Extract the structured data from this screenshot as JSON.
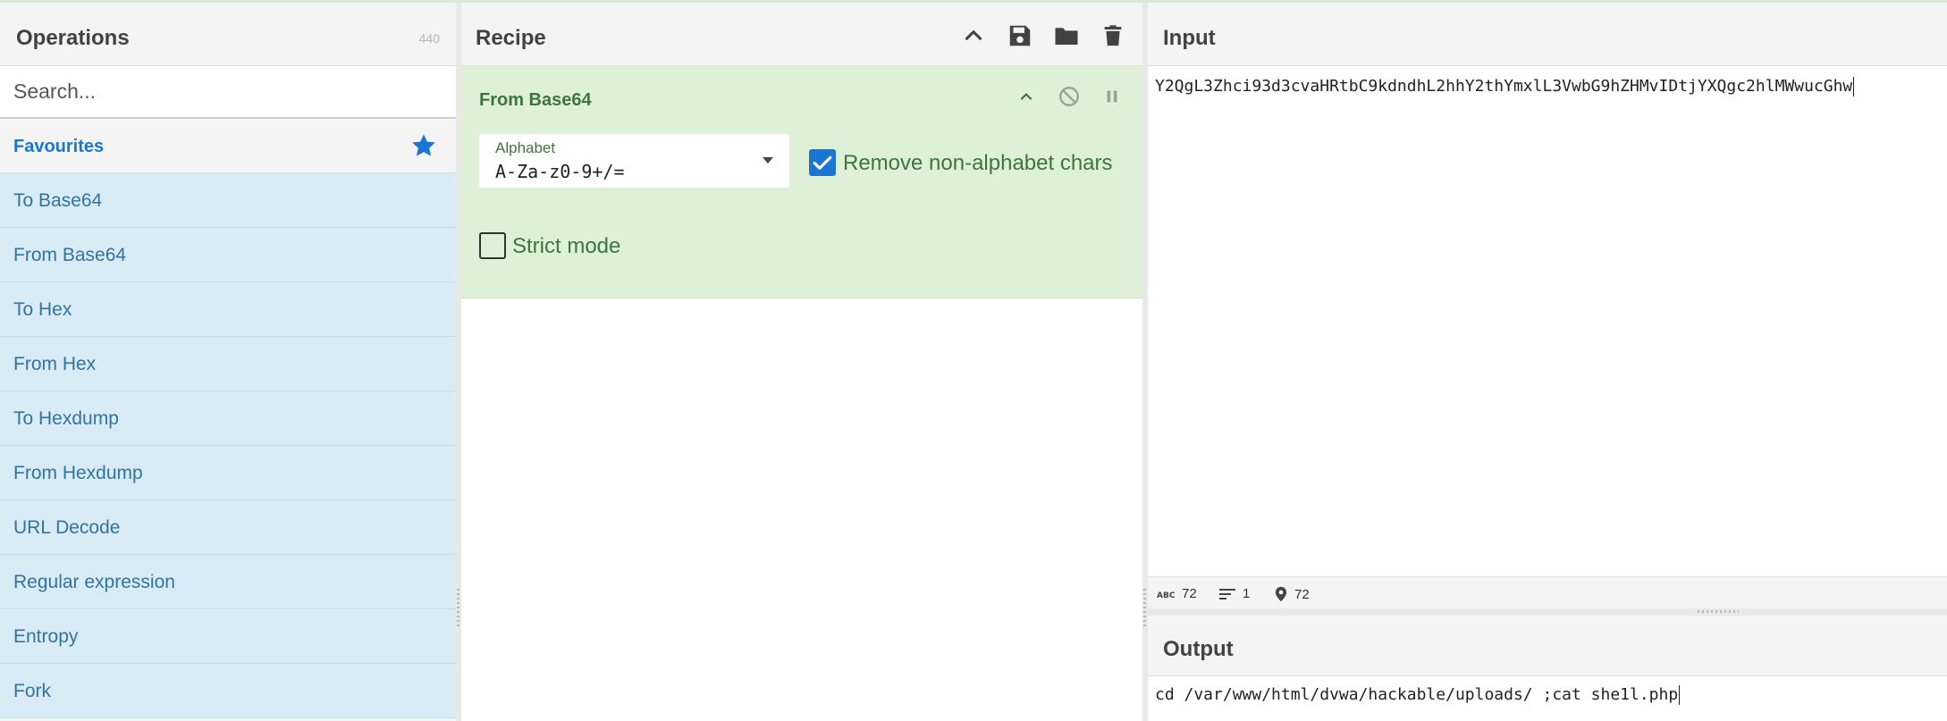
{
  "operations": {
    "title": "Operations",
    "count": "440",
    "search_placeholder": "Search...",
    "favourites_label": "Favourites",
    "items": [
      "To Base64",
      "From Base64",
      "To Hex",
      "From Hex",
      "To Hexdump",
      "From Hexdump",
      "URL Decode",
      "Regular expression",
      "Entropy",
      "Fork"
    ]
  },
  "recipe": {
    "title": "Recipe",
    "operation": {
      "name": "From Base64",
      "alphabet_label": "Alphabet",
      "alphabet_value": "A-Za-z0-9+/=",
      "remove_non_alphabet_label": "Remove non-alphabet chars",
      "remove_non_alphabet_checked": true,
      "strict_mode_label": "Strict mode",
      "strict_mode_checked": false
    }
  },
  "input": {
    "title": "Input",
    "value": "Y2QgL3Zhci93d3cvaHRtbC9kdndhL2hhY2thYmxlL3VwbG9hZHMvIDtjYXQgc2hlMWwucGhw",
    "stats": {
      "length": "72",
      "lines": "1",
      "position": "72"
    }
  },
  "output": {
    "title": "Output",
    "value": "cd /var/www/html/dvwa/hackable/uploads/ ;cat she1l.php"
  },
  "colors": {
    "accent": "#1976d2",
    "favourites_bg": "#d9ebf5",
    "recipe_card_bg": "#dff0d8",
    "recipe_card_text": "#3c763d"
  }
}
